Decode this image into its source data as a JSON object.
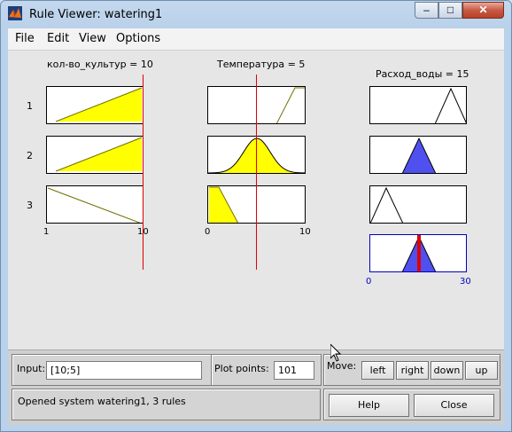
{
  "window": {
    "title": "Rule Viewer: watering1",
    "minimize_glyph": "–",
    "maximize_glyph": "□",
    "close_glyph": "✕",
    "app_icon": "matlab-icon"
  },
  "menu": [
    {
      "label": "File"
    },
    {
      "label": "Edit"
    },
    {
      "label": "View"
    },
    {
      "label": "Options"
    }
  ],
  "inputs": [
    {
      "label": "кол-во_культур = 10",
      "range": [
        1,
        10
      ],
      "value": 10,
      "tick_min": "1",
      "tick_max": "10"
    },
    {
      "label": "Температура = 5",
      "range": [
        0,
        10
      ],
      "value": 5,
      "tick_min": "0",
      "tick_max": "10"
    }
  ],
  "output": {
    "label": "Расход_воды = 15",
    "range": [
      0,
      30
    ],
    "value": 15,
    "tick_min": "0",
    "tick_max": "30"
  },
  "rules": [
    {
      "number": "1"
    },
    {
      "number": "2"
    },
    {
      "number": "3"
    }
  ],
  "colors": {
    "input_fill": "#ffff00",
    "output_fill": "#5050ee",
    "mf_line": "#707000",
    "indicator": "#e00000",
    "axis_label_blue": "#0000cc"
  },
  "controls": {
    "input_label": "Input:",
    "input_value": "[10;5]",
    "plot_points_label": "Plot points:",
    "plot_points_value": "101",
    "move_label": "Move:",
    "move_buttons": {
      "left": "left",
      "right": "right",
      "down": "down",
      "up": "up"
    },
    "help_label": "Help",
    "close_label": "Close",
    "status": "Opened system watering1, 3 rules"
  }
}
